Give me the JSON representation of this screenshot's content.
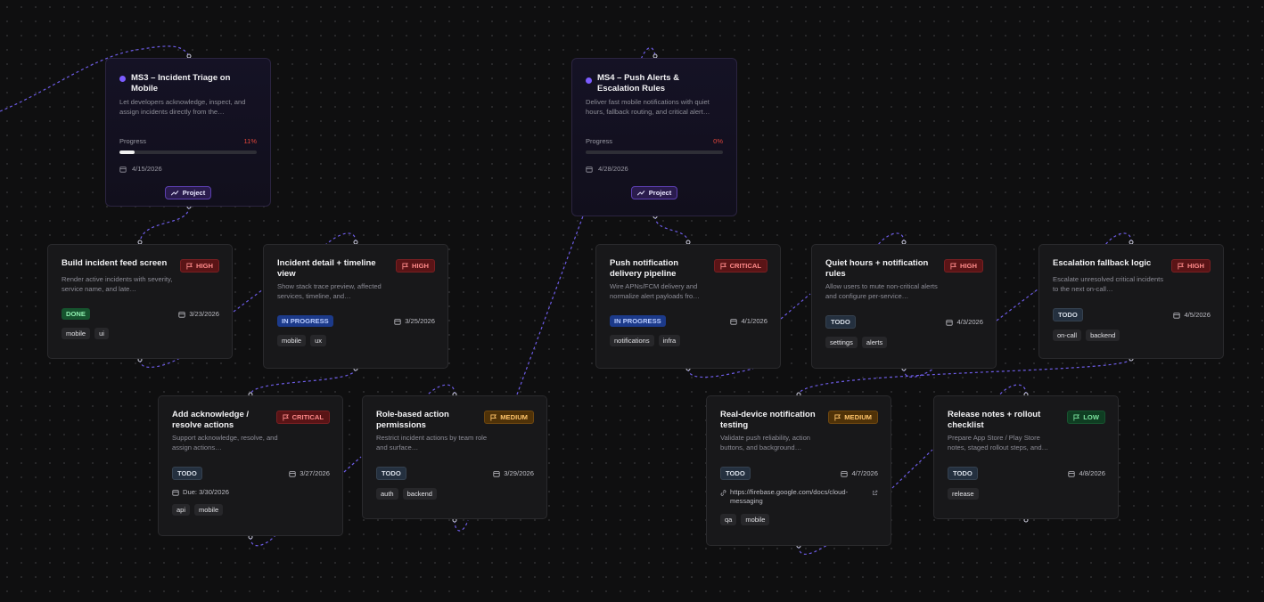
{
  "milestones": [
    {
      "title": "MS3 – Incident Triage on Mobile",
      "desc": "Let developers acknowledge, inspect, and assign incidents directly from the…",
      "progress_label": "Progress",
      "progress_pct": "11%",
      "progress": 0.11,
      "date": "4/15/2026",
      "badge": "Project"
    },
    {
      "title": "MS4 – Push Alerts & Escalation Rules",
      "desc": "Deliver fast mobile notifications with quiet hours, fallback routing, and critical alert…",
      "progress_label": "Progress",
      "progress_pct": "0%",
      "progress": 0,
      "date": "4/28/2026",
      "badge": "Project"
    }
  ],
  "tasks": [
    {
      "title": "Build incident feed screen",
      "priority": "HIGH",
      "desc": "Render active incidents with severity, service name, and late…",
      "status": "DONE",
      "date": "3/23/2026",
      "tags": [
        "mobile",
        "ui"
      ]
    },
    {
      "title": "Incident detail + timeline view",
      "priority": "HIGH",
      "desc": "Show stack trace preview, affected services, timeline, and…",
      "status": "IN PROGRESS",
      "date": "3/25/2026",
      "tags": [
        "mobile",
        "ux"
      ]
    },
    {
      "title": "Add acknowledge / resolve actions",
      "priority": "CRITICAL",
      "desc": "Support acknowledge, resolve, and assign actions…",
      "status": "TODO",
      "date": "3/27/2026",
      "due": "Due: 3/30/2026",
      "tags": [
        "api",
        "mobile"
      ]
    },
    {
      "title": "Role-based action permissions",
      "priority": "MEDIUM",
      "desc": "Restrict incident actions by team role and surface…",
      "status": "TODO",
      "date": "3/29/2026",
      "tags": [
        "auth",
        "backend"
      ]
    },
    {
      "title": "Push notification delivery pipeline",
      "priority": "CRITICAL",
      "desc": "Wire APNs/FCM delivery and normalize alert payloads fro…",
      "status": "IN PROGRESS",
      "date": "4/1/2026",
      "tags": [
        "notifications",
        "infra"
      ]
    },
    {
      "title": "Quiet hours + notification rules",
      "priority": "HIGH",
      "desc": "Allow users to mute non-critical alerts and configure per-service…",
      "status": "TODO",
      "date": "4/3/2026",
      "tags": [
        "settings",
        "alerts"
      ]
    },
    {
      "title": "Escalation fallback logic",
      "priority": "HIGH",
      "desc": "Escalate unresolved critical incidents to the next on-call…",
      "status": "TODO",
      "date": "4/5/2026",
      "tags": [
        "on-call",
        "backend"
      ]
    },
    {
      "title": "Real-device notification testing",
      "priority": "MEDIUM",
      "desc": "Validate push reliability, action buttons, and background…",
      "status": "TODO",
      "date": "4/7/2026",
      "link": "https://firebase.google.com/docs/cloud-messaging",
      "tags": [
        "qa",
        "mobile"
      ]
    },
    {
      "title": "Release notes + rollout checklist",
      "priority": "LOW",
      "desc": "Prepare App Store / Play Store notes, staged rollout steps, and…",
      "status": "TODO",
      "date": "4/8/2026",
      "tags": [
        "release"
      ]
    }
  ],
  "colors": {
    "edge": "#6d5ce6",
    "accent": "#7c5cff",
    "critical": "#e0453b"
  },
  "icons": [
    "flag-icon",
    "calendar-icon",
    "trend-icon",
    "link-icon",
    "external-link-icon"
  ]
}
